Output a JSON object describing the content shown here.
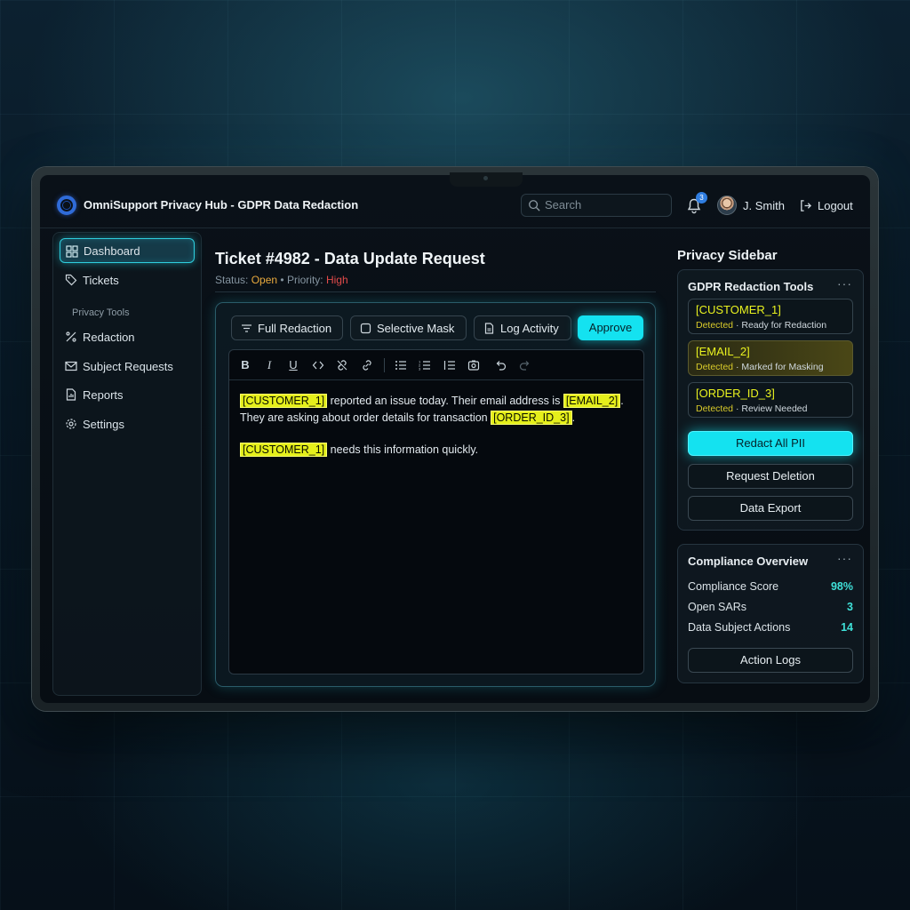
{
  "header": {
    "app_title": "OmniSupport Privacy Hub - GDPR Data Redaction",
    "search_placeholder": "Search",
    "notification_count": "3",
    "user_name": "J. Smith",
    "logout_label": "Logout"
  },
  "nav": {
    "items": [
      {
        "label": "Dashboard",
        "icon": "grid-icon"
      },
      {
        "label": "Tickets",
        "icon": "tag-icon"
      }
    ],
    "section_label": "Privacy Tools",
    "tools": [
      {
        "label": "Redaction",
        "icon": "percent-icon"
      },
      {
        "label": "Subject Requests",
        "icon": "mail-icon"
      },
      {
        "label": "Reports",
        "icon": "report-icon"
      },
      {
        "label": "Settings",
        "icon": "gear-icon"
      }
    ]
  },
  "ticket": {
    "title": "Ticket #4982 - Data Update Request",
    "status_label": "Status:",
    "status_value": "Open",
    "priority_label": "Priority:",
    "priority_value": "High"
  },
  "editor": {
    "toolbar": {
      "full_redaction": "Full Redaction",
      "selective_mask": "Selective Mask",
      "log_activity": "Log Activity",
      "approve": "Approve"
    },
    "format_buttons": [
      "B",
      "I",
      "U"
    ],
    "content": {
      "p1_tag1": "[CUSTOMER_1]",
      "p1_text1": " reported an issue today. Their email address is ",
      "p1_tag2": "[EMAIL_2]",
      "p1_text2": ".",
      "p1_text3": "They are asking about order details for transaction ",
      "p1_tag3": "[ORDER_ID_3]",
      "p1_text4": ".",
      "p2_tag1": "[CUSTOMER_1]",
      "p2_text1": " needs this information quickly."
    }
  },
  "sidebar": {
    "title": "Privacy Sidebar",
    "redaction_tools": {
      "title": "GDPR Redaction Tools",
      "menu": "···",
      "entities": [
        {
          "tag": "[CUSTOMER_1]",
          "detected": "Detected",
          "status": " · Ready for Redaction"
        },
        {
          "tag": "[EMAIL_2]",
          "detected": "Detected",
          "status": " · Marked for Masking"
        },
        {
          "tag": "[ORDER_ID_3]",
          "detected": "Detected",
          "status": " · Review Needed"
        }
      ],
      "redact_all": "Redact All PII",
      "request_deletion": "Request Deletion",
      "data_export": "Data Export"
    },
    "compliance": {
      "title": "Compliance Overview",
      "menu": "···",
      "metrics": [
        {
          "label": "Compliance Score",
          "value": "98%"
        },
        {
          "label": "Open SARs",
          "value": "3"
        },
        {
          "label": "Data Subject Actions",
          "value": "14"
        }
      ],
      "action_logs": "Action Logs"
    }
  },
  "colors": {
    "accent": "#14e2f0",
    "highlight": "#e5ef1b",
    "status_open": "#e9a93d",
    "priority_high": "#e24a4a"
  }
}
